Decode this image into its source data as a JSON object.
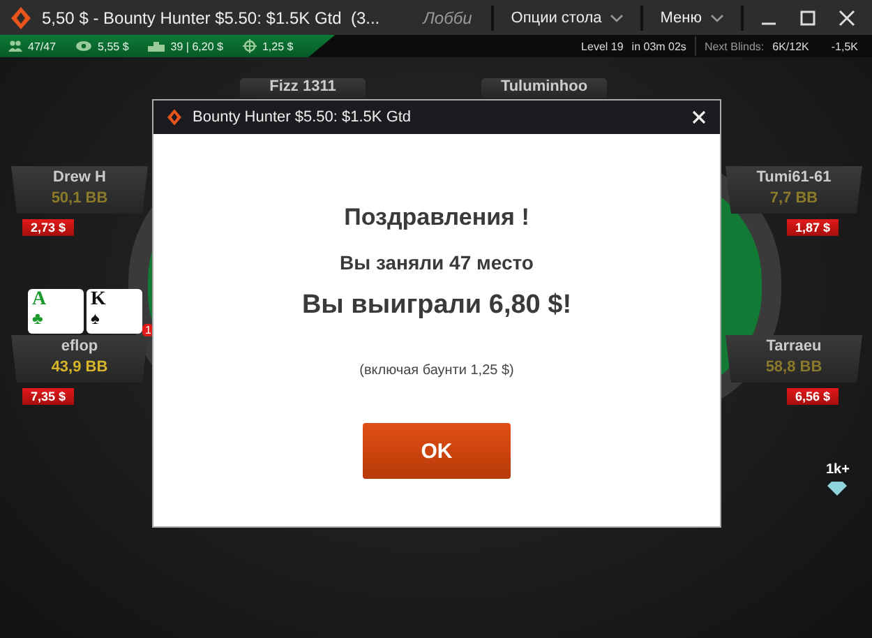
{
  "window": {
    "title": "5,50 $ - Bounty Hunter $5.50: $1.5K Gtd  (3...",
    "lobby": "Лобби",
    "menus": [
      "Опции стола",
      "Меню"
    ]
  },
  "info_bar": {
    "players": "47/47",
    "avg_stack": "5,55 $",
    "position": "39 | 6,20 $",
    "bounty": "1,25 $",
    "level": "Level 19",
    "next_in": "in 03m 02s",
    "next_blinds_label": "Next Blinds:",
    "next_blinds": "6K/12K",
    "ante": "-1,5K"
  },
  "seats": [
    {
      "name": "Fizz 1311"
    },
    {
      "name": "Tuluminhoo"
    },
    {
      "name": "Drew H",
      "stack": "50,1 BB",
      "bounty": "2,73 $",
      "hero": false
    },
    {
      "name": "Tumi61-61",
      "stack": "7,7 BB",
      "bounty": "1,87 $",
      "hero": false
    },
    {
      "name": "eflop",
      "stack": "43,9 BB",
      "bounty": "7,35 $",
      "hero": true,
      "cards": [
        {
          "rank": "A",
          "suit": "♣",
          "color": "#1a9a2a"
        },
        {
          "rank": "K",
          "suit": "♠",
          "color": "#111111"
        }
      ],
      "badge": "1"
    },
    {
      "name": "Tarraeu",
      "stack": "58,8 BB",
      "bounty": "6,56 $",
      "hero": false
    }
  ],
  "rank_badge": {
    "text": "1k+"
  },
  "dialog": {
    "title": "Bounty Hunter $5.50: $1.5K Gtd",
    "heading": "Поздравления !",
    "place": "Вы заняли 47 место",
    "winnings": "Вы выиграли 6,80 $!",
    "note": "(включая баунти 1,25 $)",
    "button": "OK"
  }
}
